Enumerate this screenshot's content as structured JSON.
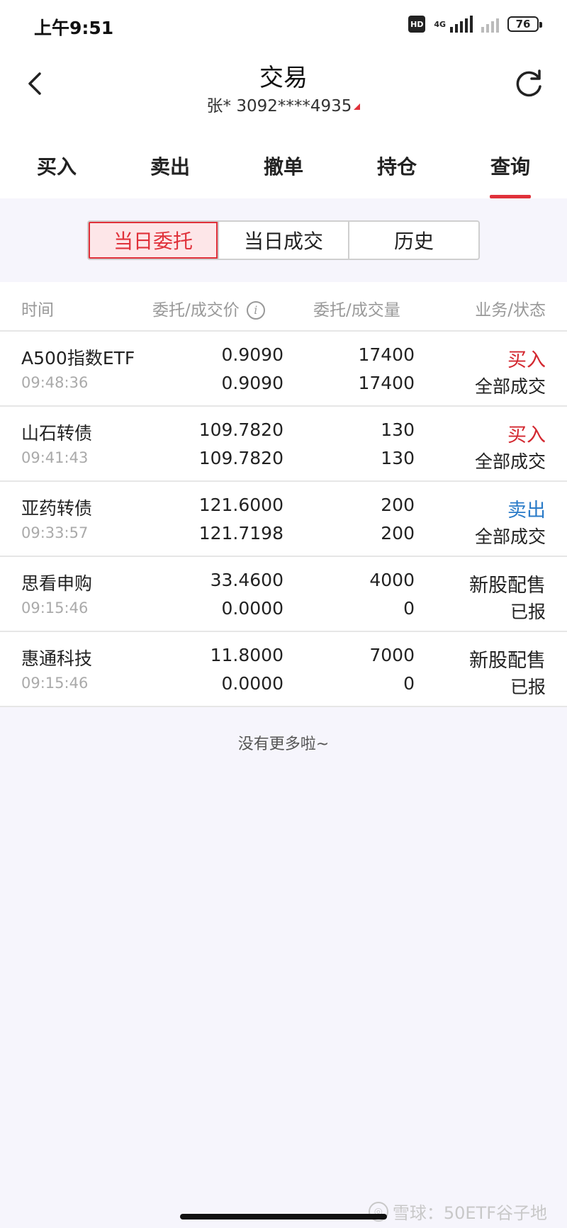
{
  "status_bar": {
    "time": "上午9:51",
    "hd": "HD",
    "network": "4G",
    "battery": "76"
  },
  "header": {
    "title": "交易",
    "account": "张* 3092****4935"
  },
  "tabs": [
    {
      "label": "买入"
    },
    {
      "label": "卖出"
    },
    {
      "label": "撤单"
    },
    {
      "label": "持仓"
    },
    {
      "label": "查询",
      "active": true
    }
  ],
  "segments": [
    {
      "label": "当日委托",
      "active": true
    },
    {
      "label": "当日成交"
    },
    {
      "label": "历史"
    }
  ],
  "table": {
    "columns": {
      "time": "时间",
      "price": "委托/成交价",
      "qty": "委托/成交量",
      "status": "业务/状态"
    },
    "rows": [
      {
        "name": "A500指数ETF",
        "time": "09:48:36",
        "order_price": "0.9090",
        "deal_price": "0.9090",
        "order_qty": "17400",
        "deal_qty": "17400",
        "business": "买入",
        "state": "全部成交",
        "kind": "buy"
      },
      {
        "name": "山石转债",
        "time": "09:41:43",
        "order_price": "109.7820",
        "deal_price": "109.7820",
        "order_qty": "130",
        "deal_qty": "130",
        "business": "买入",
        "state": "全部成交",
        "kind": "buy"
      },
      {
        "name": "亚药转债",
        "time": "09:33:57",
        "order_price": "121.6000",
        "deal_price": "121.7198",
        "order_qty": "200",
        "deal_qty": "200",
        "business": "卖出",
        "state": "全部成交",
        "kind": "sell"
      },
      {
        "name": "思看申购",
        "time": "09:15:46",
        "order_price": "33.4600",
        "deal_price": "0.0000",
        "order_qty": "4000",
        "deal_qty": "0",
        "business": "新股配售",
        "state": "已报",
        "kind": "neutral"
      },
      {
        "name": "惠通科技",
        "time": "09:15:46",
        "order_price": "11.8000",
        "deal_price": "0.0000",
        "order_qty": "7000",
        "deal_qty": "0",
        "business": "新股配售",
        "state": "已报",
        "kind": "neutral"
      }
    ]
  },
  "footer_note": "没有更多啦~",
  "watermark": "雪球：50ETF谷子地",
  "colors": {
    "accent": "#e0313a",
    "buy": "#d3272f",
    "sell": "#2a7bc8"
  }
}
